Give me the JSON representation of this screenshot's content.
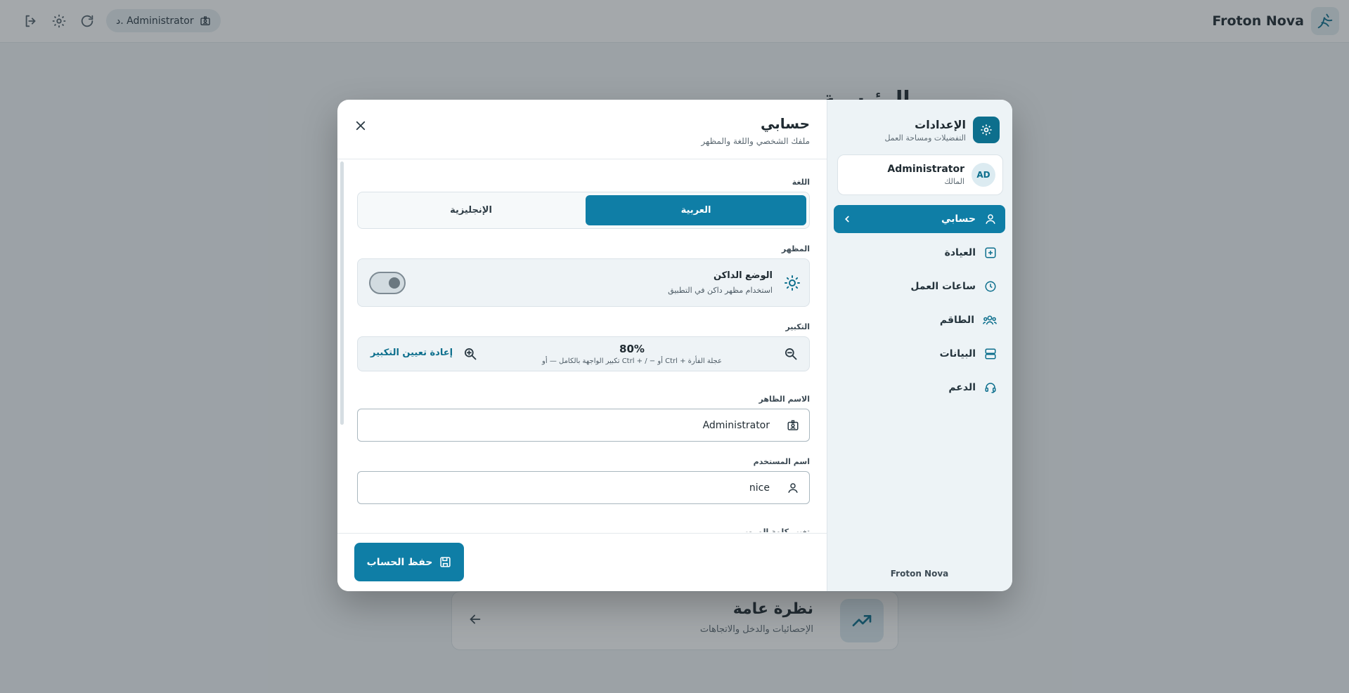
{
  "app": {
    "brand_name": "Froton Nova",
    "user_chip": "د. Administrator",
    "bg_heading": "الرئيسية",
    "bg_card": {
      "title": "نظرة عامة",
      "subtitle": "الإحصائيات والدخل والاتجاهات"
    }
  },
  "settings": {
    "title": "الإعدادات",
    "subtitle": "التفضيلات ومساحة العمل",
    "profile": {
      "initials": "AD",
      "name": "Administrator",
      "role": "المالك"
    },
    "nav": [
      {
        "label": "حسابي",
        "icon": "user-icon",
        "active": true
      },
      {
        "label": "العيادة",
        "icon": "plus-square-icon"
      },
      {
        "label": "ساعات العمل",
        "icon": "clock-icon"
      },
      {
        "label": "الطاقم",
        "icon": "team-icon"
      },
      {
        "label": "البيانات",
        "icon": "database-icon"
      },
      {
        "label": "الدعم",
        "icon": "headset-icon"
      }
    ],
    "footer": "Froton Nova"
  },
  "account": {
    "title": "حسابي",
    "subtitle": "ملفك الشخصي واللغة والمظهر",
    "language": {
      "label": "اللغة",
      "options": [
        "العربية",
        "الإنجليزية"
      ],
      "selected": "العربية"
    },
    "appearance": {
      "label": "المظهر",
      "dark_title": "الوضع الداكن",
      "dark_sub": "استخدام مظهر داكن في التطبيق",
      "dark_enabled": false
    },
    "zoom": {
      "label": "التكبير",
      "value": "80%",
      "hint": "تكبير الواجهة بالكامل — أو Ctrl + / − أو Ctrl + عجلة الفأرة",
      "reset_label": "إعادة تعيين التكبير"
    },
    "display_name": {
      "label": "الاسم الظاهر",
      "value": "Administrator"
    },
    "username": {
      "label": "اسم المستخدم",
      "value": "nice"
    },
    "next_label": "تغيير كلمة المرور",
    "save_label": "حفظ الحساب"
  },
  "colors": {
    "accent": "#0f7ea6",
    "accent_dark": "#0d6f8d"
  }
}
